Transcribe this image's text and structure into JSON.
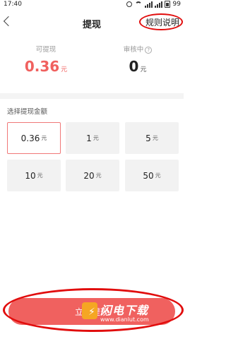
{
  "status_bar": {
    "time": "17:40",
    "battery": "99"
  },
  "header": {
    "title": "提现",
    "rules_link": "规则说明"
  },
  "balance": {
    "withdrawable_label": "可提现",
    "withdrawable_value": "0.36",
    "withdrawable_unit": "元",
    "reviewing_label": "审核中",
    "reviewing_value": "0",
    "reviewing_unit": "元"
  },
  "amount_section": {
    "label": "选择提现金额",
    "unit": "元",
    "options": [
      "0.36",
      "1",
      "5",
      "10",
      "20",
      "50"
    ],
    "selected": "0.36"
  },
  "confirm_button": {
    "label": "立即提现"
  },
  "watermark": {
    "brand": "闪电下载",
    "url": "www.dianlut.com"
  },
  "colors": {
    "accent": "#f0615f",
    "annotation": "#e10d0d"
  }
}
